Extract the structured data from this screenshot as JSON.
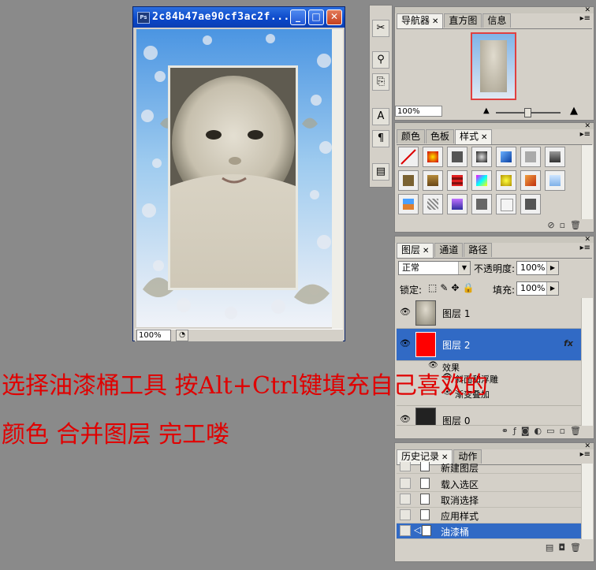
{
  "document": {
    "title": "2c84b47ae90cf3ac2f...",
    "zoom": "100%",
    "ps_badge": "Ps"
  },
  "caption": {
    "line1": "选择油漆桶工具 按Alt+Ctrl键填充自己喜欢的",
    "line2": "颜色   合并图层   完工喽"
  },
  "navigator": {
    "tabs": [
      "导航器",
      "直方图",
      "信息"
    ],
    "zoom": "100%"
  },
  "styles_panel": {
    "tabs": [
      "颜色",
      "色板",
      "样式"
    ]
  },
  "layers_panel": {
    "tabs": [
      "图层",
      "通道",
      "路径"
    ],
    "blend_mode": "正常",
    "opacity_label": "不透明度:",
    "opacity_value": "100%",
    "lock_label": "锁定:",
    "fill_label": "填充:",
    "fill_value": "100%",
    "layers": [
      {
        "name": "图层 1"
      },
      {
        "name": "图层 2",
        "fx": "fx"
      },
      {
        "name": "效果"
      },
      {
        "name": "斜面和浮雕"
      },
      {
        "name": "渐变叠加"
      },
      {
        "name": "图层 0"
      }
    ]
  },
  "history_panel": {
    "tabs": [
      "历史记录",
      "动作"
    ],
    "items": [
      "新建图层",
      "载入选区",
      "取消选择",
      "应用样式",
      "油漆桶"
    ]
  },
  "colors": {
    "layer2_fill": "#ff0000",
    "selection": "#316ac5",
    "caption": "#e00000"
  }
}
